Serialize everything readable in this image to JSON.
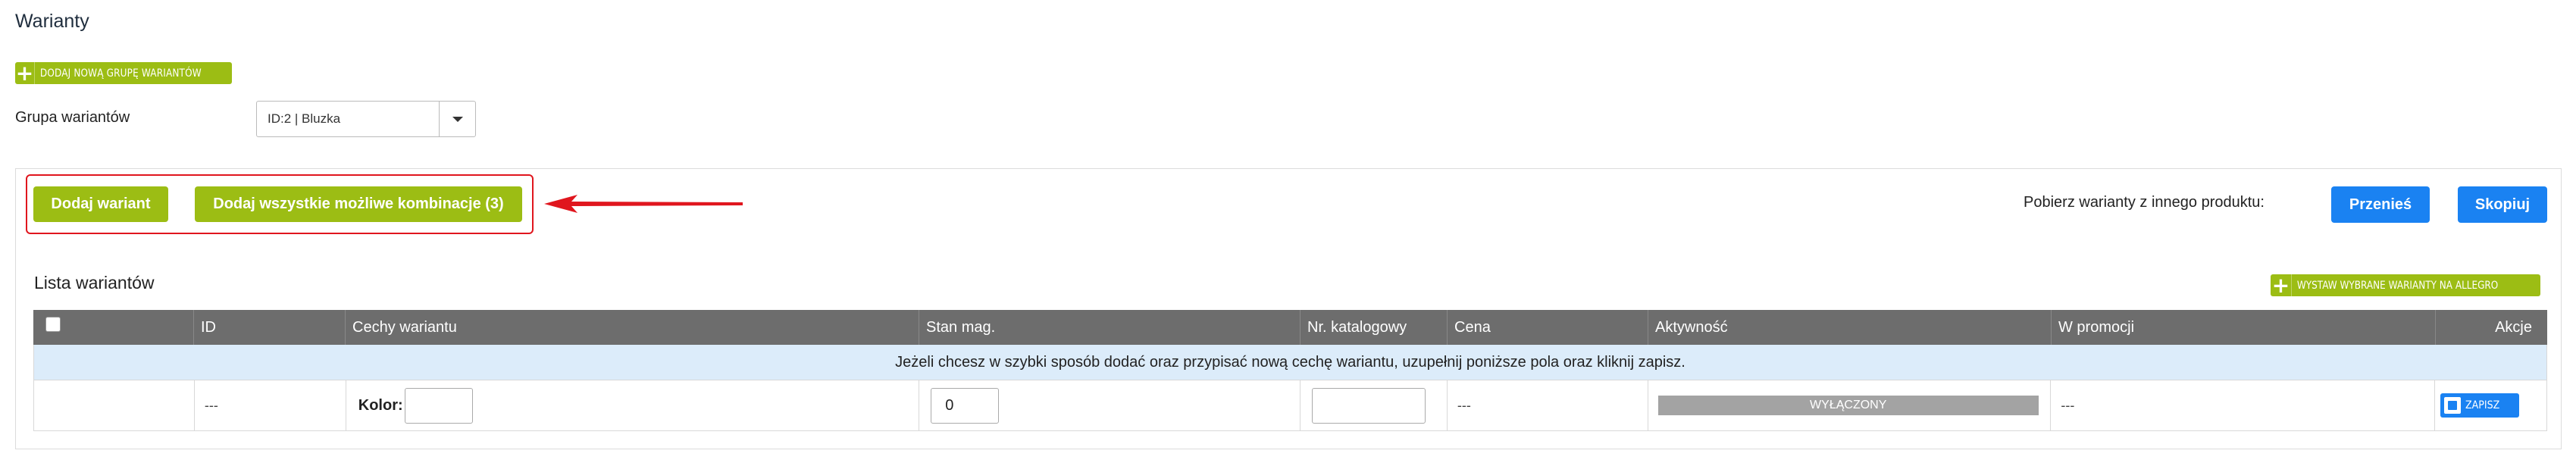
{
  "page": {
    "title": "Warianty"
  },
  "add_group_button": {
    "label": "DODAJ NOWĄ GRUPĘ WARIANTÓW",
    "icon": "plus-icon"
  },
  "group_select": {
    "label": "Grupa wariantów",
    "value": "ID:2 | Bluzka"
  },
  "actions": {
    "add_variant": "Dodaj wariant",
    "add_all_combinations": "Dodaj wszystkie możliwe kombinacje (3)"
  },
  "fetch": {
    "label": "Pobierz warianty z innego produktu:",
    "move_button": "Przenieś",
    "copy_button": "Skopiuj"
  },
  "list": {
    "title": "Lista wariantów",
    "allegro_button": "WYSTAW WYBRANE WARIANTY NA ALLEGRO",
    "columns": [
      "ID",
      "Cechy wariantu",
      "Stan mag.",
      "Nr. katalogowy",
      "Cena",
      "Aktywność",
      "W promocji",
      "Akcje"
    ],
    "info_text": "Jeżeli chcesz w szybki sposób dodać oraz przypisać nową cechę wariantu, uzupełnij poniższe pola oraz kliknij zapisz.",
    "new_row": {
      "id": "---",
      "feature_label": "Kolor:",
      "feature_value": "",
      "stock": "0",
      "catalog_number": "",
      "price": "---",
      "activity": "WYŁĄCZONY",
      "promo": "---",
      "save_button": "ZAPISZ"
    }
  },
  "colors": {
    "green": "#9cbd14",
    "blue": "#1a82f2",
    "header_gray": "#6d6d6d",
    "info_blue": "#dcecfa",
    "highlight_red": "#e0161e"
  }
}
